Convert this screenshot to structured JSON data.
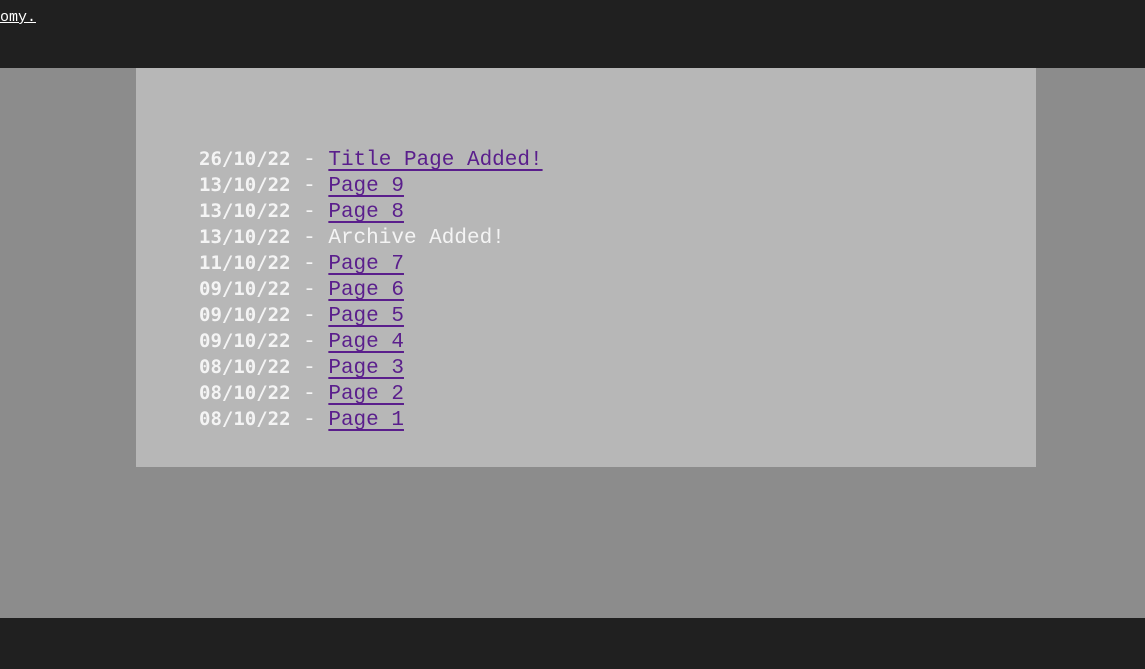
{
  "header": {
    "link_fragment": "omy."
  },
  "colors": {
    "header_bg": "#202020",
    "page_bg": "#8c8c8c",
    "panel_bg": "#b7b7b7",
    "text": "#f4f4f4",
    "link": "#5a1e8c"
  },
  "updates": [
    {
      "date": "26/10/22",
      "separator": "-",
      "text": "Title Page Added!",
      "is_link": true
    },
    {
      "date": "13/10/22",
      "separator": "-",
      "text": "Page 9",
      "is_link": true
    },
    {
      "date": "13/10/22",
      "separator": "-",
      "text": "Page 8",
      "is_link": true
    },
    {
      "date": "13/10/22",
      "separator": "-",
      "text": "Archive Added!",
      "is_link": false
    },
    {
      "date": "11/10/22",
      "separator": "-",
      "text": "Page 7",
      "is_link": true
    },
    {
      "date": "09/10/22",
      "separator": "-",
      "text": "Page 6",
      "is_link": true
    },
    {
      "date": "09/10/22",
      "separator": "-",
      "text": "Page 5",
      "is_link": true
    },
    {
      "date": "09/10/22",
      "separator": "-",
      "text": "Page 4",
      "is_link": true
    },
    {
      "date": "08/10/22",
      "separator": "-",
      "text": "Page 3",
      "is_link": true
    },
    {
      "date": "08/10/22",
      "separator": "-",
      "text": "Page 2",
      "is_link": true
    },
    {
      "date": "08/10/22",
      "separator": "-",
      "text": "Page 1",
      "is_link": true
    }
  ]
}
